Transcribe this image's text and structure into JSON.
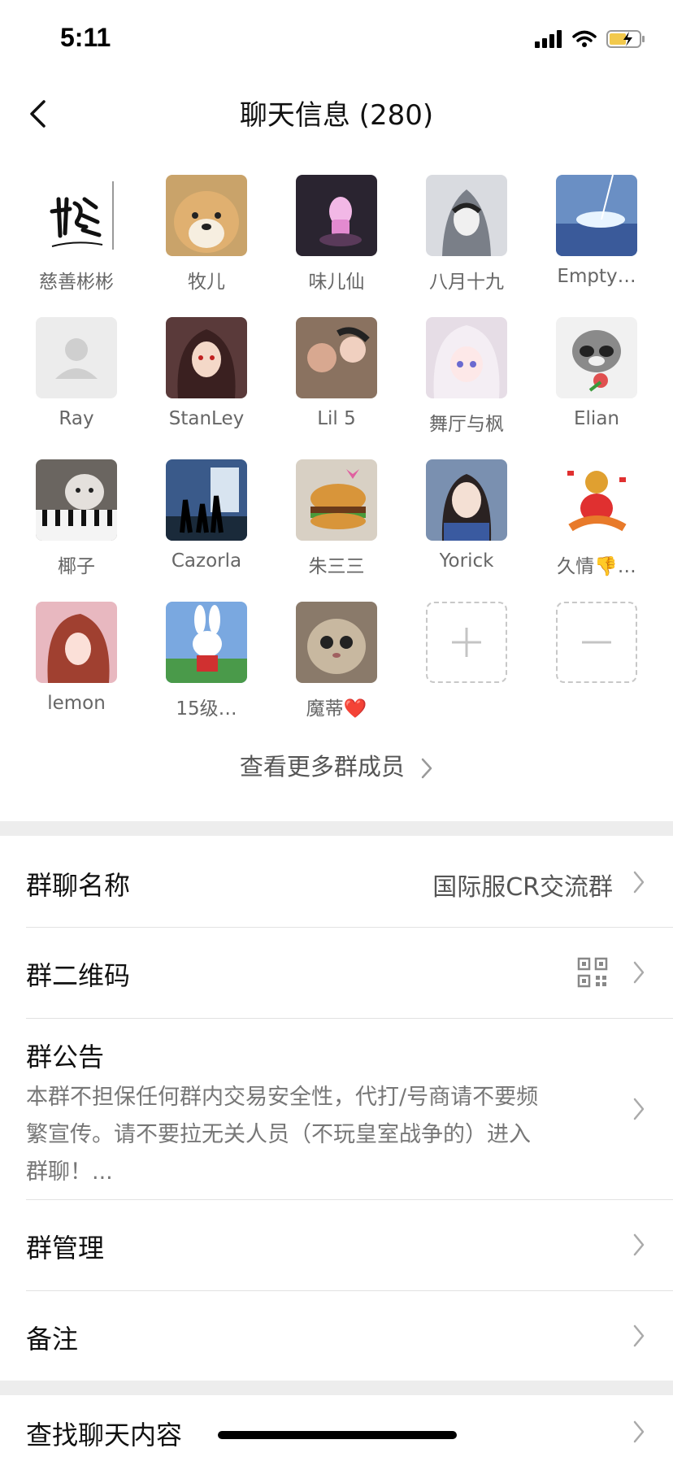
{
  "status_bar": {
    "time": "5:11"
  },
  "header": {
    "title": "聊天信息 (280)"
  },
  "members": [
    {
      "name": "慈善彬彬",
      "avatar": "calligraphy",
      "bg": "#ffffff"
    },
    {
      "name": "牧儿",
      "avatar": "shiba-dog",
      "bg": "#c9a36a"
    },
    {
      "name": "味儿仙",
      "avatar": "pink-light",
      "bg": "#2a2430"
    },
    {
      "name": "八月十九",
      "avatar": "hooded-figure",
      "bg": "#d9dbe0"
    },
    {
      "name": "Empty…",
      "avatar": "sky-light",
      "bg": "#6a8fc4"
    },
    {
      "name": "Ray",
      "avatar": "default-person",
      "bg": "#ececec"
    },
    {
      "name": "StanLey",
      "avatar": "anime-girl-dark",
      "bg": "#5a3a3a"
    },
    {
      "name": "Lil 5",
      "avatar": "couple-photo",
      "bg": "#8a7260"
    },
    {
      "name": "舞厅与枫",
      "avatar": "anime-white-hair",
      "bg": "#e6dde6"
    },
    {
      "name": "Elian",
      "avatar": "raccoon",
      "bg": "#f1f1f1"
    },
    {
      "name": "椰子",
      "avatar": "cat-piano",
      "bg": "#6a6560"
    },
    {
      "name": "Cazorla",
      "avatar": "silhouettes",
      "bg": "#3a5a8a"
    },
    {
      "name": "朱三三",
      "avatar": "burger-toy",
      "bg": "#d8d0c4"
    },
    {
      "name": "Yorick",
      "avatar": "girl-photo",
      "bg": "#7a90b0"
    },
    {
      "name": "久情👎…",
      "avatar": "tiger-god",
      "bg": "#ffffff"
    },
    {
      "name": "lemon",
      "avatar": "anime-red-hair",
      "bg": "#e8b8c0"
    },
    {
      "name": "15级…",
      "avatar": "bunny",
      "bg": "#7aa8e0"
    },
    {
      "name": "魔蒂❤️",
      "avatar": "cat-photo",
      "bg": "#8a7a6a"
    }
  ],
  "add_button": {
    "icon": "plus-icon"
  },
  "remove_button": {
    "icon": "minus-icon"
  },
  "more_members": "查看更多群成员",
  "settings": {
    "group_name": {
      "label": "群聊名称",
      "value": "国际服CR交流群"
    },
    "qr_code": {
      "label": "群二维码",
      "icon": "qr-code-icon"
    },
    "notice": {
      "label": "群公告",
      "lines": [
        "本群不担保任何群内交易安全性，代打/号商请不要频",
        "繁宣传。请不要拉无关人员（不玩皇室战争的）进入",
        "群聊！..."
      ]
    },
    "manage": {
      "label": "群管理"
    },
    "remark": {
      "label": "备注"
    },
    "search": {
      "label": "查找聊天内容"
    }
  }
}
